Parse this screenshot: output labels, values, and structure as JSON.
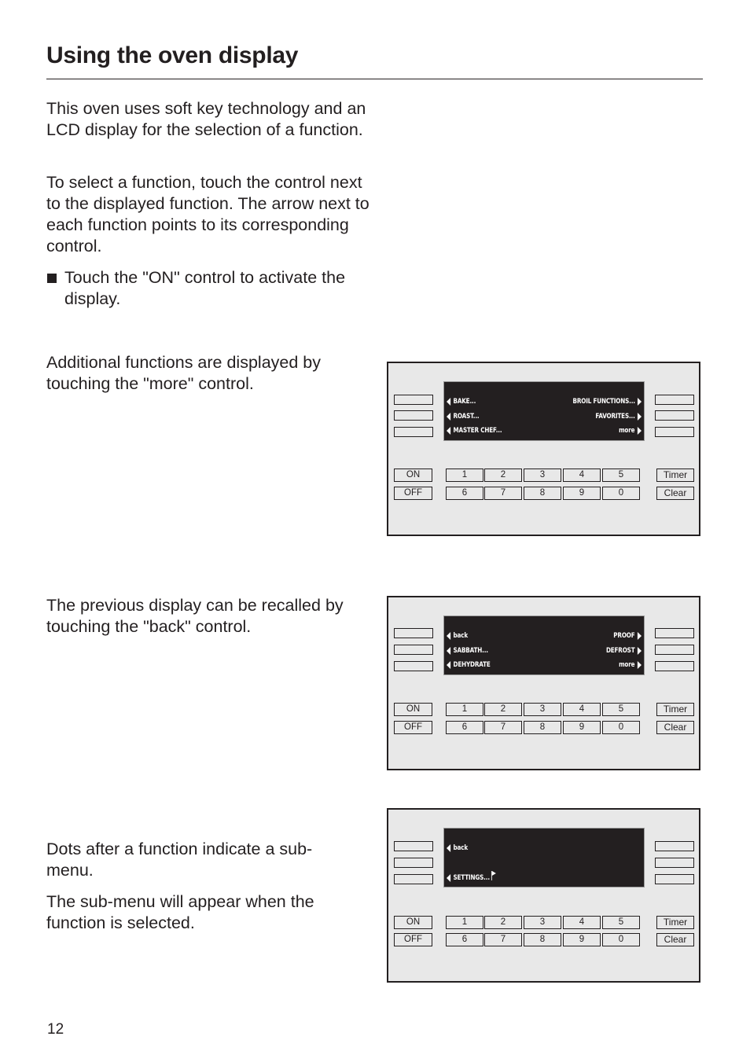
{
  "page": {
    "title": "Using the oven display",
    "page_number": "12"
  },
  "text": {
    "intro_para1": "This oven uses soft key technology and an LCD display for the selection of a function.",
    "intro_para2": "To select a function, touch the control next to the displayed function. The arrow next to each function points to its corresponding control.",
    "bullet1": "Touch the \"ON\" control to activate the display.",
    "more_para": "Additional functions are displayed by touching the \"more\" control.",
    "back_para": "The previous display can be recalled by touching the \"back\" control.",
    "dots_para1": "Dots after a function indicate a sub-menu.",
    "dots_para2": "The sub-menu will appear when the function is selected."
  },
  "keypad": {
    "on": "ON",
    "off": "OFF",
    "timer": "Timer",
    "clear": "Clear",
    "row1": [
      "1",
      "2",
      "3",
      "4",
      "5"
    ],
    "row2": [
      "6",
      "7",
      "8",
      "9",
      "0"
    ]
  },
  "displays": [
    {
      "left": [
        "BAKE...",
        "ROAST...",
        "MASTER CHEF..."
      ],
      "right": [
        "BROIL FUNCTIONS...",
        "FAVORITES...",
        "more"
      ]
    },
    {
      "left": [
        "back",
        "SABBATH...",
        "DEHYDRATE"
      ],
      "right": [
        "PROOF",
        "DEFROST",
        "more"
      ]
    },
    {
      "left": [
        "back",
        "",
        "SETTINGS..."
      ],
      "right": [
        "",
        "",
        ""
      ],
      "icons": [
        "flag-icon"
      ]
    }
  ],
  "colors": {
    "ink": "#231f20",
    "panel_bg": "#e8e8e8",
    "lcd_bg": "#231f20",
    "lcd_text": "#ffffff"
  }
}
